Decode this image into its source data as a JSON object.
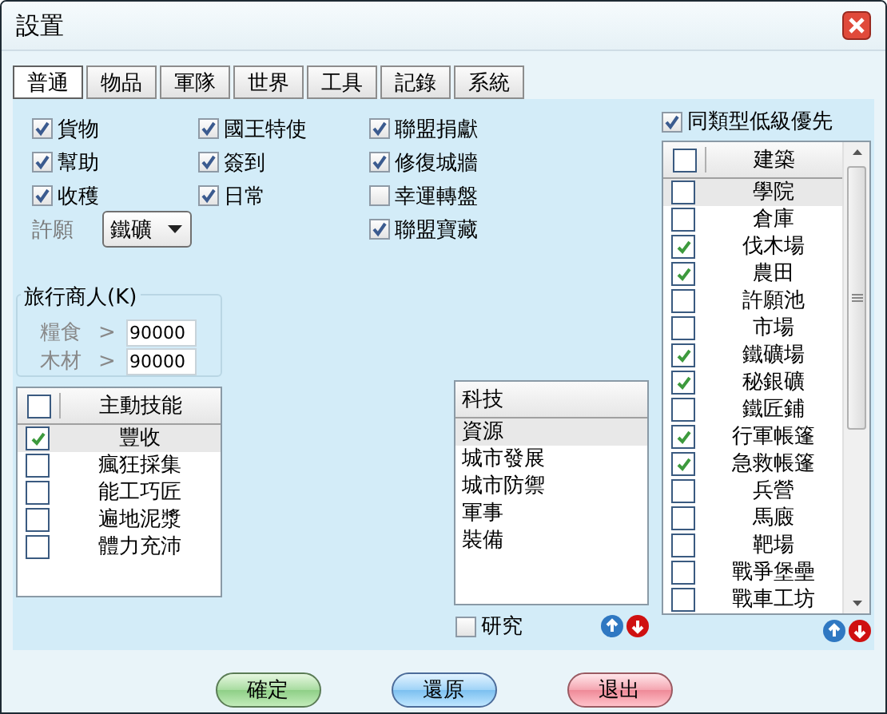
{
  "window": {
    "title": "設置"
  },
  "tabs": [
    {
      "label": "普通",
      "selected": true
    },
    {
      "label": "物品",
      "selected": false
    },
    {
      "label": "軍隊",
      "selected": false
    },
    {
      "label": "世界",
      "selected": false
    },
    {
      "label": "工具",
      "selected": false
    },
    {
      "label": "記錄",
      "selected": false
    },
    {
      "label": "系統",
      "selected": false
    }
  ],
  "option_columns": [
    [
      {
        "label": "貨物",
        "checked": true
      },
      {
        "label": "幫助",
        "checked": true
      },
      {
        "label": "收穫",
        "checked": true
      }
    ],
    [
      {
        "label": "國王特使",
        "checked": true
      },
      {
        "label": "簽到",
        "checked": true
      },
      {
        "label": "日常",
        "checked": true
      }
    ],
    [
      {
        "label": "聯盟捐獻",
        "checked": true
      },
      {
        "label": "修復城牆",
        "checked": true
      },
      {
        "label": "幸運轉盤",
        "checked": false
      },
      {
        "label": "聯盟寶藏",
        "checked": true
      }
    ]
  ],
  "wish": {
    "label": "許願",
    "value": "鐵礦"
  },
  "traveling_merchant": {
    "title": "旅行商人(K)",
    "fields": [
      {
        "label": "糧食",
        "operator": ">",
        "value": "90000"
      },
      {
        "label": "木材",
        "operator": ">",
        "value": "90000"
      }
    ]
  },
  "skills": {
    "header": "主動技能",
    "header_checked": false,
    "rows": [
      {
        "label": "豐收",
        "checked": true,
        "selected": true
      },
      {
        "label": "瘋狂採集",
        "checked": false,
        "selected": false
      },
      {
        "label": "能工巧匠",
        "checked": false,
        "selected": false
      },
      {
        "label": "遍地泥漿",
        "checked": false,
        "selected": false
      },
      {
        "label": "體力充沛",
        "checked": false,
        "selected": false
      }
    ]
  },
  "tech": {
    "header": "科技",
    "rows": [
      {
        "label": "資源",
        "selected": true
      },
      {
        "label": "城市發展",
        "selected": false
      },
      {
        "label": "城市防禦",
        "selected": false
      },
      {
        "label": "軍事",
        "selected": false
      },
      {
        "label": "裝備",
        "selected": false
      }
    ]
  },
  "research": {
    "label": "研究",
    "checked": false
  },
  "low_level_first": {
    "label": "同類型低級優先",
    "checked": true
  },
  "buildings": {
    "header": "建築",
    "header_checked": false,
    "rows": [
      {
        "label": "學院",
        "checked": false,
        "selected": true
      },
      {
        "label": "倉庫",
        "checked": false,
        "selected": false
      },
      {
        "label": "伐木場",
        "checked": true,
        "selected": false
      },
      {
        "label": "農田",
        "checked": true,
        "selected": false
      },
      {
        "label": "許願池",
        "checked": false,
        "selected": false
      },
      {
        "label": "市場",
        "checked": false,
        "selected": false
      },
      {
        "label": "鐵礦場",
        "checked": true,
        "selected": false
      },
      {
        "label": "秘銀礦",
        "checked": true,
        "selected": false
      },
      {
        "label": "鐵匠鋪",
        "checked": false,
        "selected": false
      },
      {
        "label": "行軍帳篷",
        "checked": true,
        "selected": false
      },
      {
        "label": "急救帳篷",
        "checked": true,
        "selected": false
      },
      {
        "label": "兵營",
        "checked": false,
        "selected": false
      },
      {
        "label": "馬廄",
        "checked": false,
        "selected": false
      },
      {
        "label": "靶場",
        "checked": false,
        "selected": false
      },
      {
        "label": "戰爭堡壘",
        "checked": false,
        "selected": false
      },
      {
        "label": "戰車工坊",
        "checked": false,
        "selected": false
      }
    ]
  },
  "buttons": [
    {
      "label": "確定",
      "kind": "confirm"
    },
    {
      "label": "還原",
      "kind": "restore"
    },
    {
      "label": "退出",
      "kind": "exit"
    }
  ]
}
